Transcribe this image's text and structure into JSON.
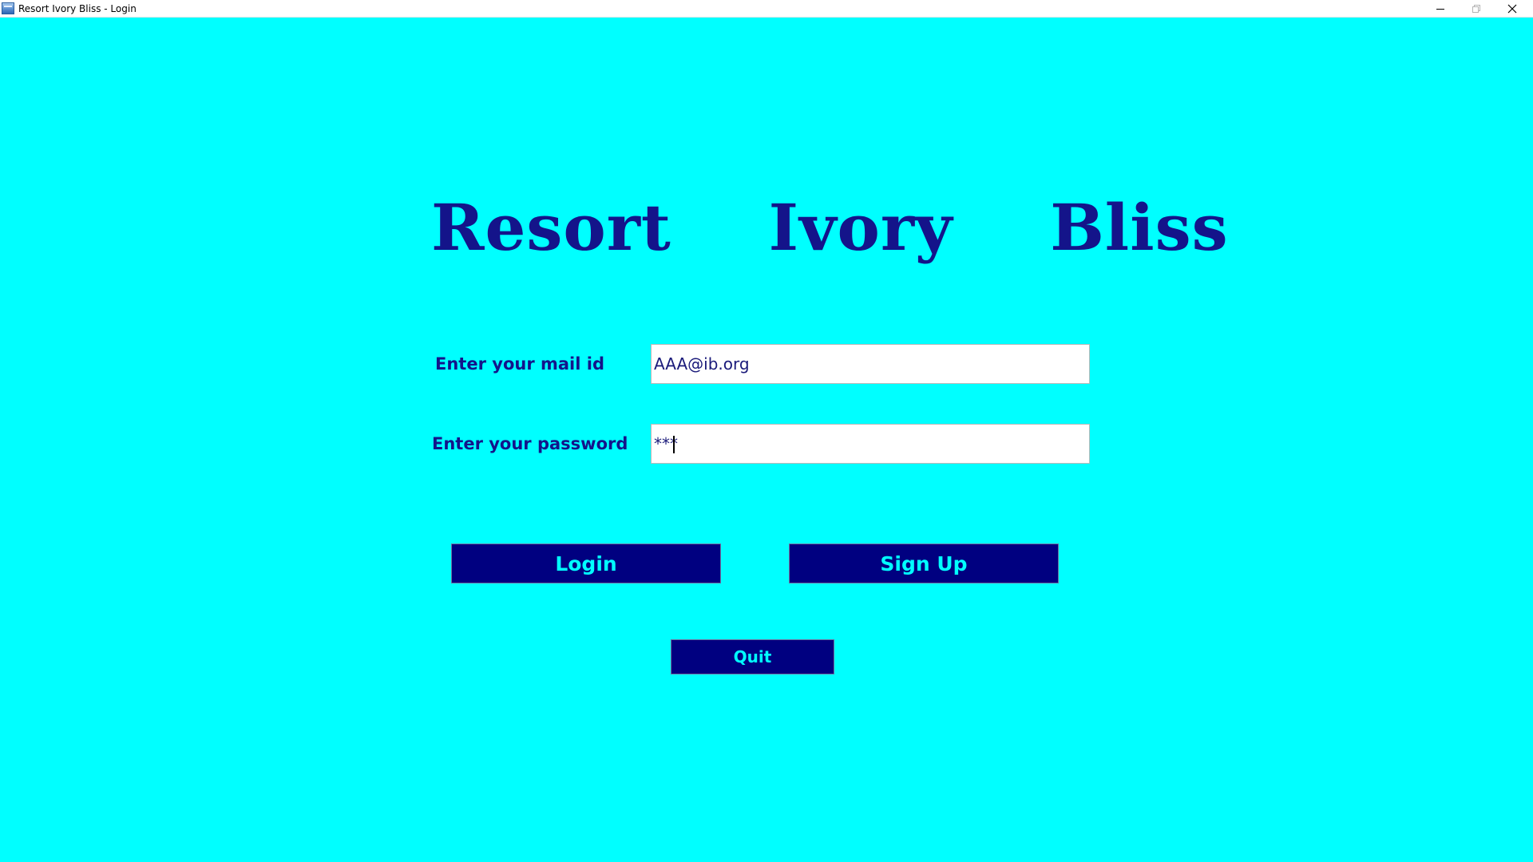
{
  "window": {
    "title": "Resort Ivory Bliss - Login",
    "controls": {
      "minimize_icon": "minimize-icon",
      "maximize_icon": "maximize-icon",
      "close_icon": "close-icon"
    }
  },
  "heading": "Resort  Ivory  Bliss",
  "form": {
    "mail_label": "Enter your mail id",
    "mail_value": "AAA@ib.org",
    "password_label": "Enter your password",
    "password_value": "***"
  },
  "buttons": {
    "login": "Login",
    "signup": "Sign Up",
    "quit": "Quit"
  },
  "colors": {
    "background": "#00ffff",
    "heading": "#14148a",
    "button_bg": "#000080",
    "button_text": "#00ffff"
  }
}
